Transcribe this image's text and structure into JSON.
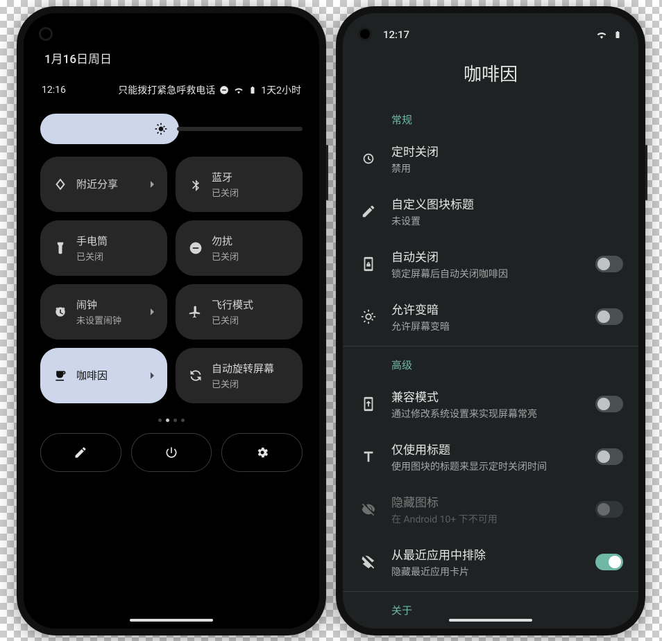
{
  "left": {
    "date": "1月16日周日",
    "time": "12:16",
    "network_text": "只能拨打紧急呼救电话",
    "battery_text": "1天2小时",
    "tiles": [
      {
        "id": "nearby-share",
        "title": "附近分享",
        "sub": "",
        "chevron": true,
        "active": false,
        "icon": "nearby"
      },
      {
        "id": "bluetooth",
        "title": "蓝牙",
        "sub": "已关闭",
        "chevron": false,
        "active": false,
        "icon": "bluetooth"
      },
      {
        "id": "flashlight",
        "title": "手电筒",
        "sub": "已关闭",
        "chevron": false,
        "active": false,
        "icon": "flashlight"
      },
      {
        "id": "dnd",
        "title": "勿扰",
        "sub": "已关闭",
        "chevron": false,
        "active": false,
        "icon": "dnd"
      },
      {
        "id": "alarm",
        "title": "闹钟",
        "sub": "未设置闹钟",
        "chevron": true,
        "active": false,
        "icon": "alarm"
      },
      {
        "id": "airplane",
        "title": "飞行模式",
        "sub": "已关闭",
        "chevron": false,
        "active": false,
        "icon": "airplane"
      },
      {
        "id": "caffeine",
        "title": "咖啡因",
        "sub": "",
        "chevron": true,
        "active": true,
        "icon": "coffee"
      },
      {
        "id": "autorotate",
        "title": "自动旋转屏幕",
        "sub": "已关闭",
        "chevron": false,
        "active": false,
        "icon": "rotate"
      }
    ],
    "pager_count": 4,
    "pager_active": 1
  },
  "right": {
    "time": "12:17",
    "app_title": "咖啡因",
    "sections": {
      "general_label": "常规",
      "advanced_label": "高级",
      "about_label": "关于"
    },
    "settings": [
      {
        "id": "scheduled-off",
        "section": "general",
        "title": "定时关闭",
        "sub": "禁用",
        "switch": null,
        "icon": "timer"
      },
      {
        "id": "custom-title",
        "section": "general",
        "title": "自定义图块标题",
        "sub": "未设置",
        "switch": null,
        "icon": "edit"
      },
      {
        "id": "auto-off",
        "section": "general",
        "title": "自动关闭",
        "sub": "锁定屏幕后自动关闭咖啡因",
        "switch": false,
        "icon": "lock-phone"
      },
      {
        "id": "allow-dim",
        "section": "general",
        "title": "允许变暗",
        "sub": "允许屏幕变暗",
        "switch": false,
        "icon": "brightness"
      },
      {
        "id": "compat",
        "section": "advanced",
        "title": "兼容模式",
        "sub": "通过修改系统设置来实现屏幕常亮",
        "switch": false,
        "icon": "install"
      },
      {
        "id": "title-only",
        "section": "advanced",
        "title": "仅使用标题",
        "sub": "使用图块的标题来显示定时关闭时间",
        "switch": false,
        "icon": "text"
      },
      {
        "id": "hide-icon",
        "section": "advanced",
        "title": "隐藏图标",
        "sub": "在 Android 10+ 下不可用",
        "switch": false,
        "icon": "eye-off",
        "disabled": true
      },
      {
        "id": "exclude-recent",
        "section": "advanced",
        "title": "从最近应用中排除",
        "sub": "隐藏最近应用卡片",
        "switch": true,
        "icon": "layers-off"
      }
    ]
  }
}
